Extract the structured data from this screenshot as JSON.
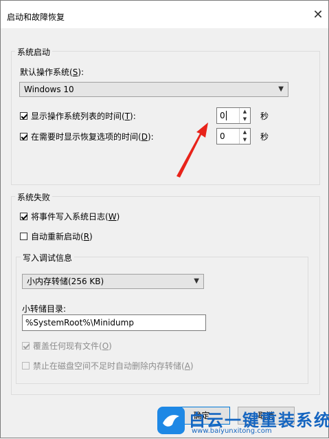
{
  "window": {
    "title": "启动和故障恢复",
    "close_glyph": "✕"
  },
  "system_startup": {
    "group_label": "系统启动",
    "default_os_label": "默认操作系统",
    "default_os_key": "S",
    "default_os_value": "Windows 10",
    "show_os_list": {
      "label": "显示操作系统列表的时间",
      "key": "T",
      "checked": true,
      "value": "0",
      "unit": "秒"
    },
    "show_recovery": {
      "label": "在需要时显示恢复选项的时间",
      "key": "D",
      "checked": true,
      "value": "0",
      "unit": "秒"
    }
  },
  "system_failure": {
    "group_label": "系统失败",
    "write_event": {
      "label": "将事件写入系统日志",
      "key": "W",
      "checked": true
    },
    "auto_restart": {
      "label": "自动重新启动",
      "key": "R",
      "checked": false
    },
    "debug_info": {
      "group_label": "写入调试信息",
      "dump_type_value": "小内存转储(256 KB)",
      "dump_dir_label": "小转储目录:",
      "dump_dir_value": "%SystemRoot%\\Minidump",
      "overwrite": {
        "label": "覆盖任何现有文件",
        "key": "O",
        "checked": true,
        "disabled": true
      },
      "disable_auto_delete": {
        "label": "禁止在磁盘空间不足时自动删除内存转储",
        "key": "A",
        "checked": false,
        "disabled": true
      }
    }
  },
  "buttons": {
    "ok": "确定",
    "cancel": "取消"
  },
  "watermark": {
    "text": "白云一键重装系统",
    "url": "www.baiyunxitong.com"
  },
  "colors": {
    "annotation_arrow": "#e8231a",
    "accent": "#0078d7",
    "watermark": "#1565c0"
  },
  "icons": {
    "dropdown": "chevron-down-icon",
    "spin_up": "triangle-up-icon",
    "spin_down": "triangle-down-icon",
    "close": "close-icon"
  }
}
